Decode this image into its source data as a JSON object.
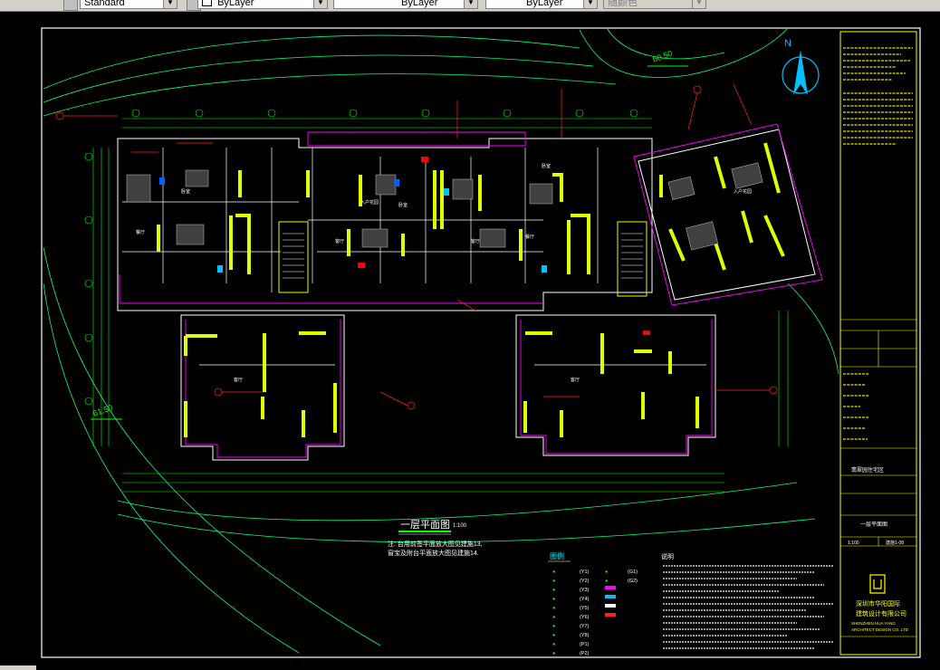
{
  "toolbar": {
    "textstyle": "Standard",
    "layer": "ByLayer",
    "linetype": "ByLayer",
    "lineweight": "ByLayer",
    "plotstyle": "随颜色"
  },
  "drawing": {
    "north_label": "N",
    "level_label_top": "60.50",
    "level_label_left": "61.50",
    "plan_title": "一层平面图",
    "plan_scale": "1:100",
    "note_line1": "注: 台用前签平面放大图见建施13,",
    "note_line2": "窗宝及附台平面放大图见建施14.",
    "legend_title": "图例",
    "notes_title": "说明",
    "legend_codes": [
      "(Y1)",
      "(Y2)",
      "(Y3)",
      "(Y4)",
      "(Y5)",
      "(Y6)",
      "(Y7)",
      "(Y8)",
      "(P1)",
      "(P2)"
    ],
    "legend_codes_right": [
      "(G1)",
      "(G2)"
    ],
    "room_labels": [
      "客厅",
      "客厅",
      "餐厅",
      "餐厅",
      "卧室",
      "卧室",
      "客厅",
      "客厅",
      "卧室",
      "入户花园",
      "入户花园"
    ]
  },
  "title_block": {
    "company_name": "深圳市华阳国际",
    "company_name2": "建筑设计有限公司",
    "company_en1": "SHENZHEN HUA YANG",
    "company_en2": "ARCHITECT DESIGN CO.,LTD",
    "project": "翡翠园住宅区",
    "drawing_name": "一层平面图",
    "scale": "1:100",
    "sheet": "建施1-08"
  }
}
